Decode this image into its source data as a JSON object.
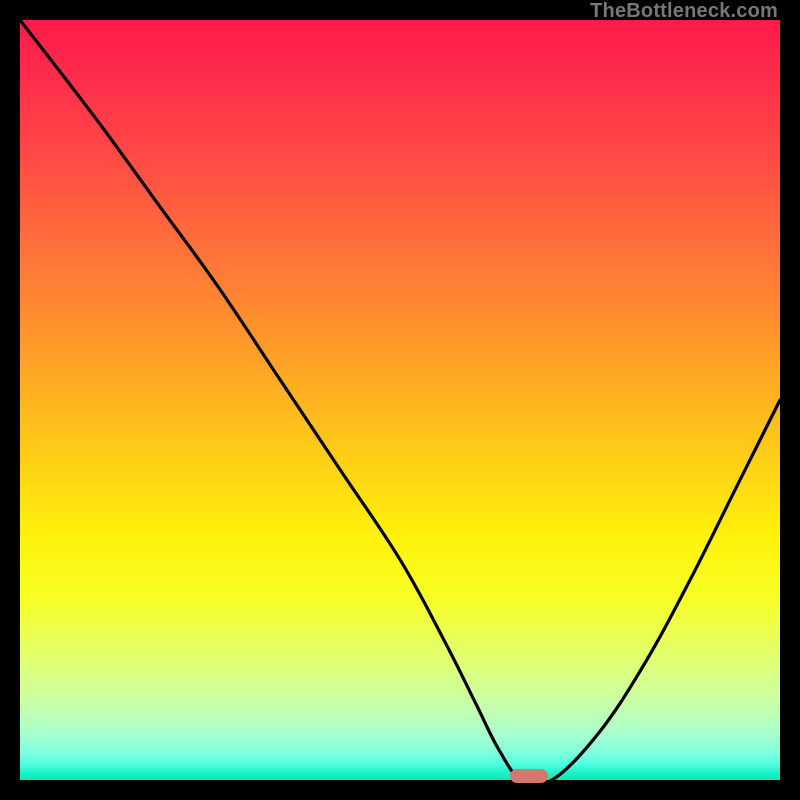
{
  "watermark": "TheBottleneck.com",
  "colors": {
    "background": "#000000",
    "curve_stroke": "#000000",
    "marker_fill": "#d4786d",
    "gradient_top": "#ff1a4b",
    "gradient_bottom": "#0ee7b4"
  },
  "chart_data": {
    "type": "line",
    "title": "",
    "xlabel": "",
    "ylabel": "",
    "xlim": [
      0,
      100
    ],
    "ylim": [
      0,
      100
    ],
    "grid": false,
    "legend": false,
    "annotations": [
      {
        "text": "TheBottleneck.com",
        "position": "top-right"
      }
    ],
    "series": [
      {
        "name": "bottleneck-curve",
        "x": [
          0,
          10,
          18,
          26,
          34,
          42,
          50,
          56,
          60,
          63,
          66,
          70,
          76,
          82,
          88,
          94,
          100
        ],
        "values": [
          100,
          87,
          76,
          65,
          53,
          41,
          29,
          18,
          10,
          4,
          0,
          0,
          6,
          15,
          26,
          38,
          50
        ]
      }
    ],
    "marker": {
      "x": 67,
      "y": 0,
      "shape": "pill",
      "color": "#d4786d"
    }
  }
}
